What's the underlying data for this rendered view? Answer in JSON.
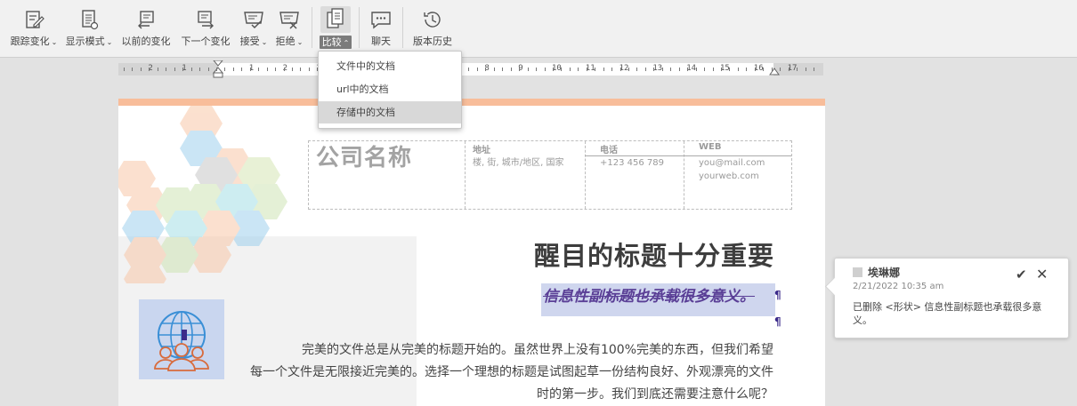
{
  "toolbar": {
    "buttons": [
      {
        "label": "跟踪变化",
        "caret": "⌄"
      },
      {
        "label": "显示模式",
        "caret": "⌄"
      },
      {
        "label": "以前的变化"
      },
      {
        "label": "下一个变化"
      },
      {
        "label": "接受",
        "caret": "⌄"
      },
      {
        "label": "拒绝",
        "caret": "⌄"
      },
      {
        "label": "比较",
        "caret": "⌃"
      },
      {
        "label": "聊天"
      },
      {
        "label": "版本历史"
      }
    ]
  },
  "compare_menu": {
    "items": [
      "文件中的文档",
      "url中的文档",
      "存储中的文档"
    ],
    "selected": "存储中的文档"
  },
  "ruler": {
    "numbers": [
      "2",
      "1",
      "1",
      "2",
      "3",
      "4",
      "5",
      "6",
      "7",
      "8",
      "9",
      "10",
      "11",
      "12",
      "13",
      "14",
      "15",
      "16",
      "17"
    ]
  },
  "document": {
    "company": "公司名称",
    "header": {
      "address_label": "地址",
      "address_value": "楼, 街, 城市/地区, 国家",
      "phone_label": "电话",
      "phone_value": "+123 456 789",
      "web_label": "WEB",
      "web_email": "you@mail.com",
      "web_site": "yourweb.com"
    },
    "title": "醒目的标题十分重要",
    "subtitle": "信息性副标题也承载很多意义。",
    "paragraph_mark": "¶",
    "body_lines": [
      "完美的文件总是从完美的标题开始的。虽然世界上没有100%完美的东西，但我们希望",
      "每一个文件是无限接近完美的。选择一个理想的标题是试图起草一份结构良好、外观漂亮的文件",
      "时的第一步。我们到底还需要注意什么呢？"
    ]
  },
  "comment": {
    "author": "埃琳娜",
    "date": "2/21/2022 10:35 am",
    "text": "已删除 <形状> 信息性副标题也承载很多意义。",
    "accept_icon": "✔",
    "reject_icon": "✕"
  },
  "colors": {
    "accent_page_band": "#f8bd9a",
    "subtitle": "#5a3f96",
    "highlight": "#cfd6ee"
  }
}
